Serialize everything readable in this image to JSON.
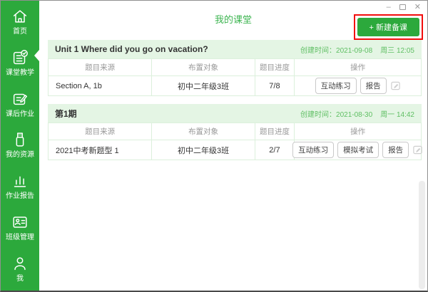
{
  "window": {
    "controls": {
      "minimize": "–",
      "close": "✕"
    }
  },
  "sidebar": {
    "items": [
      {
        "label": "首页"
      },
      {
        "label": "课堂教学"
      },
      {
        "label": "课后作业"
      },
      {
        "label": "我的资源"
      },
      {
        "label": "作业报告"
      },
      {
        "label": "班级管理"
      },
      {
        "label": "我"
      }
    ]
  },
  "header": {
    "title": "我的课堂",
    "new_lesson_button": "+ 新建备课"
  },
  "columns": [
    "题目来源",
    "布置对象",
    "题目进度",
    "操作"
  ],
  "sections": [
    {
      "title": "Unit 1 Where did you go on vacation?",
      "created": "创建时间：2021-09-08",
      "created_week": "周三 12:05",
      "row": {
        "source": "Section A, 1b",
        "target": "初中二年级3班",
        "progress": "7/8",
        "actions": [
          "互动练习",
          "报告"
        ]
      }
    },
    {
      "title": "第1期",
      "created": "创建时间：2021-08-30",
      "created_week": "周一 14:42",
      "row": {
        "source": "2021中考新题型 1",
        "target": "初中二年级3班",
        "progress": "2/7",
        "actions": [
          "互动练习",
          "模拟考试",
          "报告"
        ]
      }
    }
  ],
  "colors": {
    "brand_green": "#2ca93c",
    "title_green": "#3db551",
    "light_green_bg": "#e4f5e4",
    "table_border_green": "#dcf0dc",
    "created_text_green": "#5fbf63",
    "annotation_red": "#f20d0d"
  }
}
